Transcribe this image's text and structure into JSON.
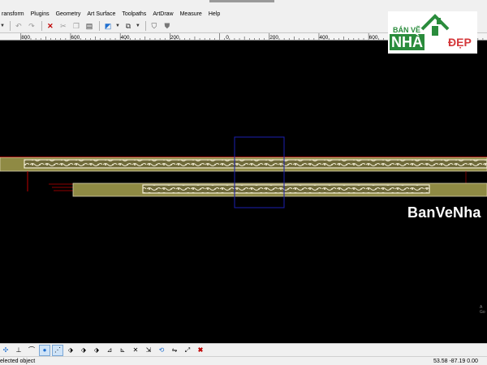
{
  "menu": {
    "items": [
      "Transform",
      "Plugins",
      "Geometry",
      "Art Surface",
      "Toolpaths",
      "ArtDraw",
      "Measure",
      "Help"
    ],
    "visible_labels": [
      "ransform",
      "Plugins",
      "Geometry",
      "Art Surface",
      "Toolpaths",
      "ArtDraw",
      "Measure",
      "Help"
    ]
  },
  "ruler": {
    "ticks": [
      "800",
      "600",
      "400",
      "200",
      "0",
      "200",
      "400",
      "600",
      "800"
    ]
  },
  "watermark": {
    "logo_top": "BÁN VẼ",
    "logo_main": "NHÀ",
    "logo_accent": "ĐẸP",
    "canvas_text": "BanVeNha"
  },
  "status": {
    "text": "elected object",
    "coords": "53.58 -87.19 0.00"
  },
  "colors": {
    "canvas": "#000000",
    "panel_fill": "#8f8a44",
    "panel_border": "#d8d0b0",
    "selection_box": "#1b1fb0",
    "guide_red": "#c00000",
    "logo_green": "#2a8c3c",
    "logo_red": "#d4373a"
  },
  "icons": {
    "toolbar": [
      "dropdown-arrow-icon",
      "undo-icon",
      "redo-icon",
      "delete-icon",
      "cut-icon",
      "copy-icon",
      "paste-icon",
      "blue-view-icon",
      "layers-icon",
      "shield-icon",
      "shield-solid-icon"
    ],
    "bottombar": [
      "snap-icon",
      "perpendicular-icon",
      "tangent-icon",
      "point-icon",
      "node-icon",
      "transform-a-icon",
      "transform-b-icon",
      "transform-c-icon",
      "align-icon",
      "measure-icon",
      "trim-icon",
      "extend-icon",
      "rotate-icon",
      "mirror-icon",
      "stretch-icon",
      "close-icon"
    ]
  }
}
